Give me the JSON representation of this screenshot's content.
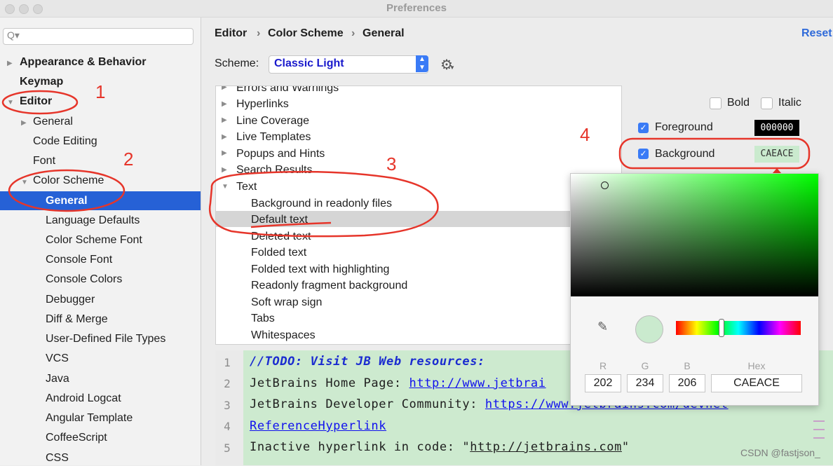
{
  "window": {
    "title": "Preferences"
  },
  "sidebar": {
    "search_placeholder": "Q▾",
    "items": [
      {
        "label": "Appearance & Behavior"
      },
      {
        "label": "Keymap"
      },
      {
        "label": "Editor"
      },
      {
        "label": "General"
      },
      {
        "label": "Code Editing"
      },
      {
        "label": "Font"
      },
      {
        "label": "Color Scheme"
      },
      {
        "label": "General"
      },
      {
        "label": "Language Defaults"
      },
      {
        "label": "Color Scheme Font"
      },
      {
        "label": "Console Font"
      },
      {
        "label": "Console Colors"
      },
      {
        "label": "Debugger"
      },
      {
        "label": "Diff & Merge"
      },
      {
        "label": "User-Defined File Types"
      },
      {
        "label": "VCS"
      },
      {
        "label": "Java"
      },
      {
        "label": "Android Logcat"
      },
      {
        "label": "Angular Template"
      },
      {
        "label": "CoffeeScript"
      },
      {
        "label": "CSS"
      }
    ]
  },
  "header": {
    "breadcrumb": [
      "Editor",
      "›",
      "Color Scheme",
      "›",
      "General"
    ],
    "reset_label": "Reset"
  },
  "scheme": {
    "label": "Scheme:",
    "value": "Classic Light"
  },
  "attributes_list": {
    "items": [
      "Errors and Warnings",
      "Hyperlinks",
      "Line Coverage",
      "Live Templates",
      "Popups and Hints",
      "Search Results",
      "Text",
      "Background in readonly files",
      "Default text",
      "Deleted text",
      "Folded text",
      "Folded text with highlighting",
      "Readonly fragment background",
      "Soft wrap sign",
      "Tabs",
      "Whitespaces"
    ],
    "selected": "Default text"
  },
  "attributes": {
    "bold_label": "Bold",
    "italic_label": "Italic",
    "foreground_label": "Foreground",
    "foreground_value": "000000",
    "background_label": "Background",
    "background_value": "CAEACE"
  },
  "color_picker": {
    "labels": [
      "R",
      "G",
      "B",
      "Hex"
    ],
    "r": "202",
    "g": "234",
    "b": "206",
    "hex": "CAEACE",
    "swatch_color": "#caeace"
  },
  "preview": {
    "line_numbers": [
      "1",
      "2",
      "3",
      "4",
      "5"
    ],
    "line1": "//TODO: Visit JB Web resources:",
    "line2_prefix": "JetBrains Home Page: ",
    "line2_link": "http://www.jetbrai",
    "line3_prefix": "JetBrains Developer Community: ",
    "line3_link": "https://www.jetbrains.com/devnet",
    "line4_link": "ReferenceHyperlink",
    "line5_prefix": "Inactive hyperlink in code: \"",
    "line5_link": "http://jetbrains.com",
    "line5_suffix": "\""
  },
  "annotations": [
    "1",
    "2",
    "3",
    "4"
  ],
  "watermark": "CSDN @fastjson_",
  "colors": {
    "selection": "#2661d6",
    "checkbox": "#3a7bf6",
    "preview_bg": "#cdeacf",
    "annotation": "#e6352a"
  }
}
